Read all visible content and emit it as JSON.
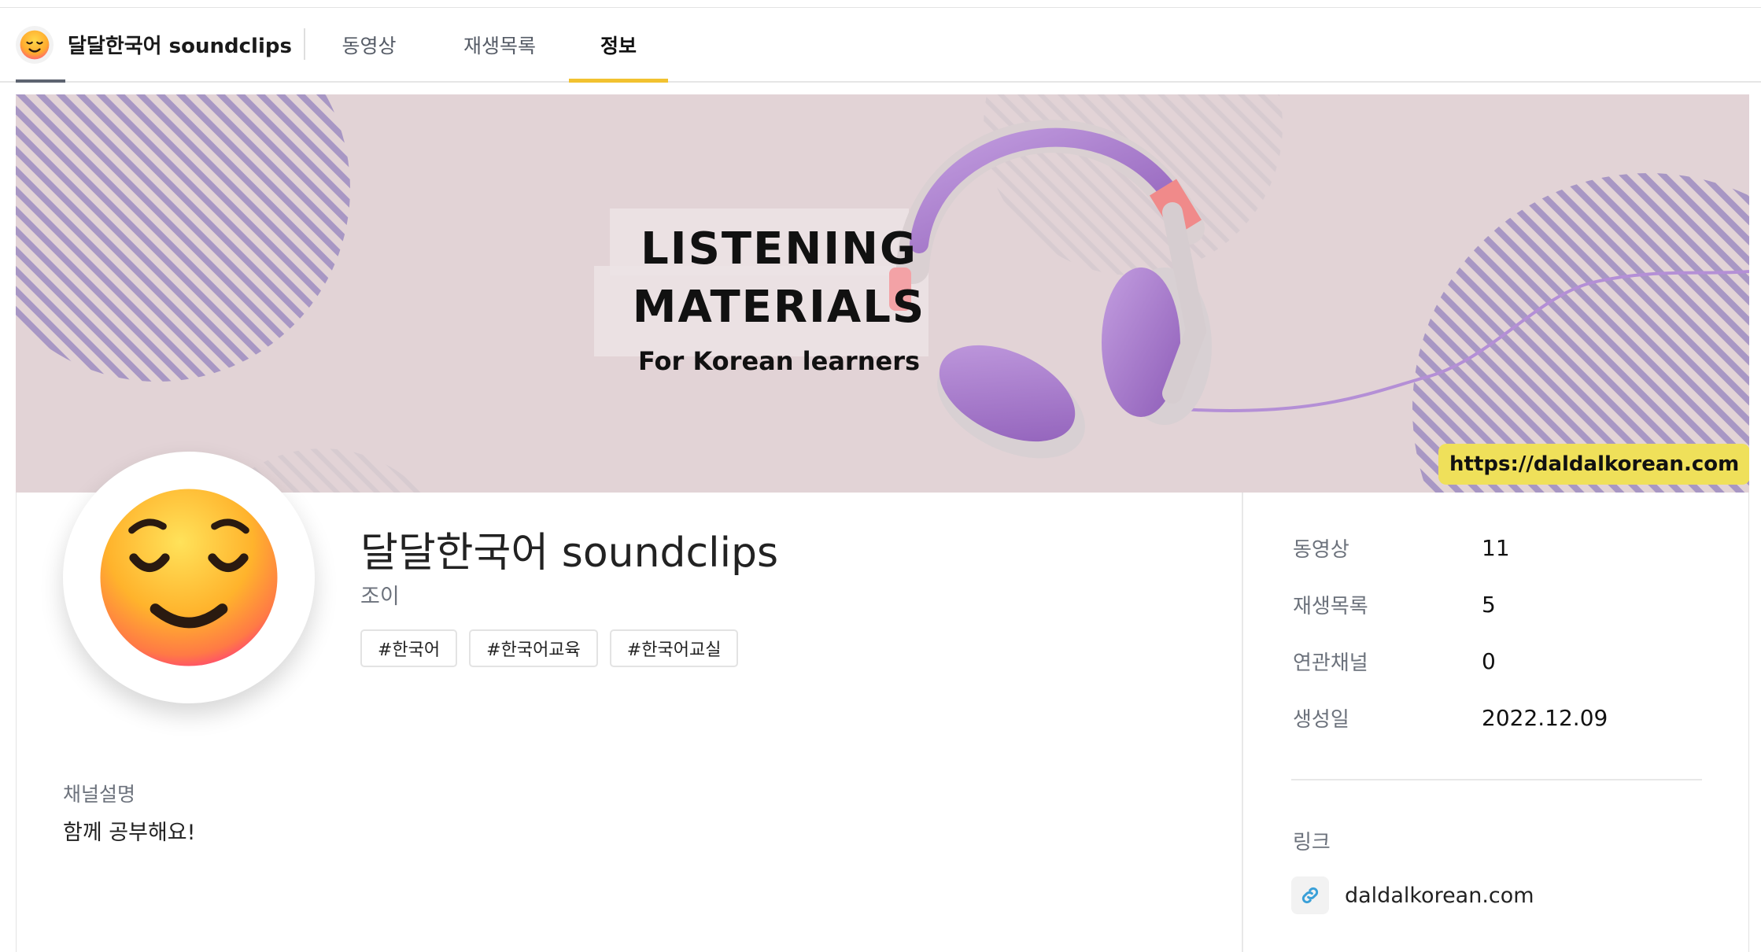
{
  "nav": {
    "channel_title": "달달한국어 soundclips",
    "tabs": [
      {
        "label": "동영상"
      },
      {
        "label": "재생목록"
      },
      {
        "label": "정보"
      }
    ],
    "active_tab": "정보",
    "accent_color": "#f2c230"
  },
  "banner": {
    "title_line1": "LISTENING",
    "title_line2": "MATERIALS",
    "subtitle": "For Korean learners",
    "url": "https://daldalkorean.com",
    "background_color": "#e2d3d6"
  },
  "channel": {
    "title": "달달한국어 soundclips",
    "owner": "조이",
    "tags": [
      "#한국어",
      "#한국어교육",
      "#한국어교실"
    ],
    "avatar_icon": "relieved-face-emoji-icon",
    "description_label": "채널설명",
    "description": "함께 공부해요!"
  },
  "stats": [
    {
      "label": "동영상",
      "value": "11"
    },
    {
      "label": "재생목록",
      "value": "5"
    },
    {
      "label": "연관채널",
      "value": "0"
    },
    {
      "label": "생성일",
      "value": "2022.12.09"
    }
  ],
  "links": {
    "label": "링크",
    "items": [
      {
        "text": "daldalkorean.com",
        "icon": "link-icon"
      }
    ]
  }
}
